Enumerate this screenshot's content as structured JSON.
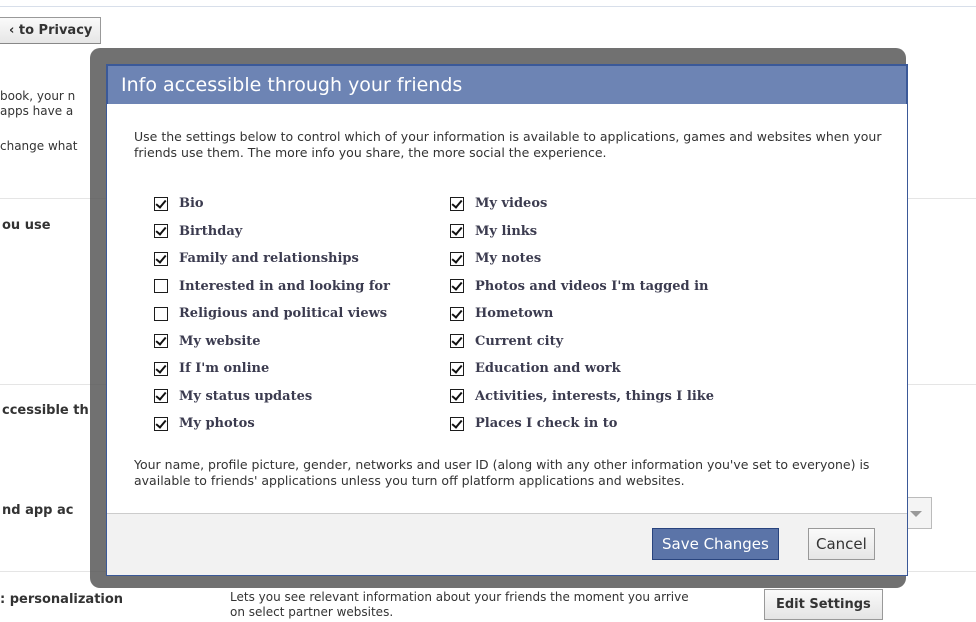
{
  "background": {
    "back_button": "‹ to Privacy",
    "intro_line1": "book, your n",
    "intro_line2": "apps have a",
    "intro_line3": "change what",
    "section_apps": "ou use",
    "section_accessible": "ccessible th",
    "section_app_activity": "nd app ac",
    "section_personalization": ": personalization",
    "personalization_desc": "Lets you see relevant information about your friends the moment you arrive on select partner websites.",
    "edit_settings": "Edit Settings"
  },
  "dialog": {
    "title": "Info accessible through your friends",
    "description": "Use the settings below to control which of your information is available to applications, games and websites when your friends use them. The more info you share, the more social the experience.",
    "left_options": [
      {
        "label": "Bio",
        "checked": true
      },
      {
        "label": "Birthday",
        "checked": true
      },
      {
        "label": "Family and relationships",
        "checked": true
      },
      {
        "label": "Interested in and looking for",
        "checked": false
      },
      {
        "label": "Religious and political views",
        "checked": false
      },
      {
        "label": "My website",
        "checked": true
      },
      {
        "label": "If I'm online",
        "checked": true
      },
      {
        "label": "My status updates",
        "checked": true
      },
      {
        "label": "My photos",
        "checked": true
      }
    ],
    "right_options": [
      {
        "label": "My videos",
        "checked": true
      },
      {
        "label": "My links",
        "checked": true
      },
      {
        "label": "My notes",
        "checked": true
      },
      {
        "label": "Photos and videos I'm tagged in",
        "checked": true
      },
      {
        "label": "Hometown",
        "checked": true
      },
      {
        "label": "Current city",
        "checked": true
      },
      {
        "label": "Education and work",
        "checked": true
      },
      {
        "label": "Activities, interests, things I like",
        "checked": true
      },
      {
        "label": "Places I check in to",
        "checked": true
      }
    ],
    "note": "Your name, profile picture, gender, networks and user ID (along with any other information you've set to everyone) is available to friends' applications unless you turn off platform applications and websites.",
    "save_label": "Save Changes",
    "cancel_label": "Cancel"
  },
  "colors": {
    "title_bar": "#6d84b4",
    "save_button": "#5b74a8",
    "frame": "#525252"
  }
}
